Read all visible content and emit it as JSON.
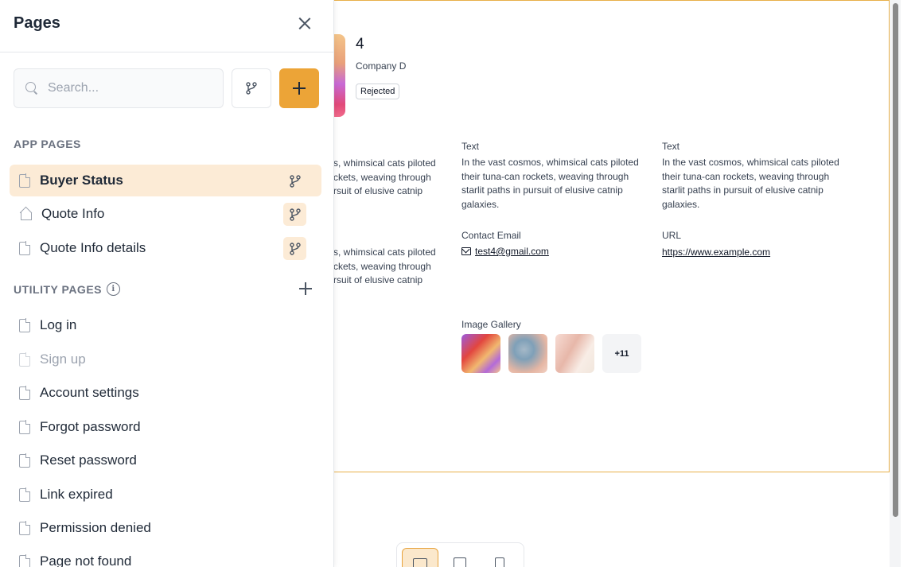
{
  "panel": {
    "title": "Pages",
    "search_placeholder": "Search...",
    "app_pages_label": "APP PAGES",
    "utility_pages_label": "UTILITY PAGES",
    "app_pages": [
      {
        "label": "Buyer Status",
        "icon": "document-icon",
        "active": true
      },
      {
        "label": "Quote Info",
        "icon": "home-icon",
        "active": false
      },
      {
        "label": "Quote Info details",
        "icon": "document-icon",
        "active": false
      }
    ],
    "utility_pages": [
      {
        "label": "Log in"
      },
      {
        "label": "Sign up"
      },
      {
        "label": "Account settings"
      },
      {
        "label": "Forgot password"
      },
      {
        "label": "Reset password"
      },
      {
        "label": "Link expired"
      },
      {
        "label": "Permission denied"
      },
      {
        "label": "Page not found"
      }
    ]
  },
  "record": {
    "title": "4",
    "company": "Company D",
    "status": "Rejected",
    "cut_text_lines": [
      "s, whimsical cats piloted",
      "ckets, weaving through",
      "rsuit of elusive catnip"
    ],
    "cut_text_lines_2": [
      "s, whimsical cats piloted",
      "ckets, weaving through",
      "rsuit of elusive catnip"
    ],
    "text_label_1": "Text",
    "text_value_1": "In the vast cosmos, whimsical cats piloted their tuna-can rockets, weaving through starlit paths in pursuit of elusive catnip galaxies.",
    "text_label_2": "Text",
    "text_value_2": "In the vast cosmos, whimsical cats piloted their tuna-can rockets, weaving through starlit paths in pursuit of elusive catnip galaxies.",
    "contact_label": "Contact Email",
    "contact_email": "test4@gmail.com",
    "url_label": "URL",
    "url_value": "https://www.example.com",
    "gallery_label": "Image Gallery",
    "gallery_more": "+11"
  },
  "colors": {
    "accent": "#eca437",
    "accent_light": "#fcebd6",
    "frame_border": "#e8b04a"
  }
}
